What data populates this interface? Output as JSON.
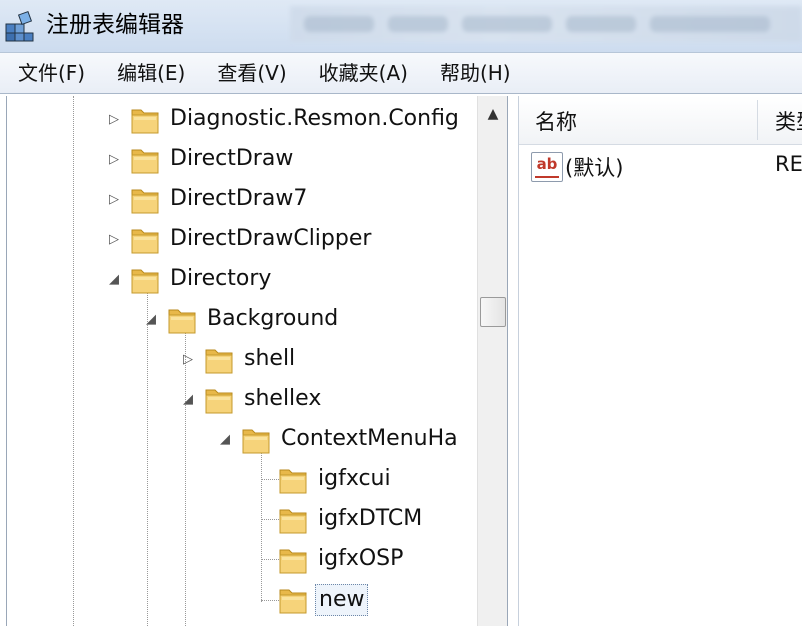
{
  "window": {
    "title": "注册表编辑器"
  },
  "menu": {
    "items": [
      {
        "label": "文件(F)"
      },
      {
        "label": "编辑(E)"
      },
      {
        "label": "查看(V)"
      },
      {
        "label": "收藏夹(A)"
      },
      {
        "label": "帮助(H)"
      }
    ]
  },
  "tree": {
    "nodes": [
      {
        "label": "Diagnostic.Resmon.Config",
        "expander": "collapsed",
        "level": 0
      },
      {
        "label": "DirectDraw",
        "expander": "collapsed",
        "level": 0
      },
      {
        "label": "DirectDraw7",
        "expander": "collapsed",
        "level": 0
      },
      {
        "label": "DirectDrawClipper",
        "expander": "collapsed",
        "level": 0
      },
      {
        "label": "Directory",
        "expander": "expanded",
        "level": 0
      },
      {
        "label": "Background",
        "expander": "expanded",
        "level": 1
      },
      {
        "label": "shell",
        "expander": "collapsed",
        "level": 2
      },
      {
        "label": "shellex",
        "expander": "expanded",
        "level": 2
      },
      {
        "label": "ContextMenuHa",
        "expander": "expanded",
        "level": 3
      },
      {
        "label": "igfxcui",
        "expander": "none",
        "level": 4
      },
      {
        "label": "igfxDTCM",
        "expander": "none",
        "level": 4
      },
      {
        "label": "igfxOSP",
        "expander": "none",
        "level": 4
      },
      {
        "label": "new",
        "expander": "none",
        "level": 4,
        "selected": true
      }
    ]
  },
  "list": {
    "columns": {
      "name": "名称",
      "type": "类型"
    },
    "rows": [
      {
        "name": "(默认)",
        "type": "RE",
        "icon": "string-value-ab-icon"
      }
    ]
  },
  "colors": {
    "folder": "#e8b84a",
    "titlebar": "#d6e2f1",
    "menubar": "#eef2f8"
  }
}
